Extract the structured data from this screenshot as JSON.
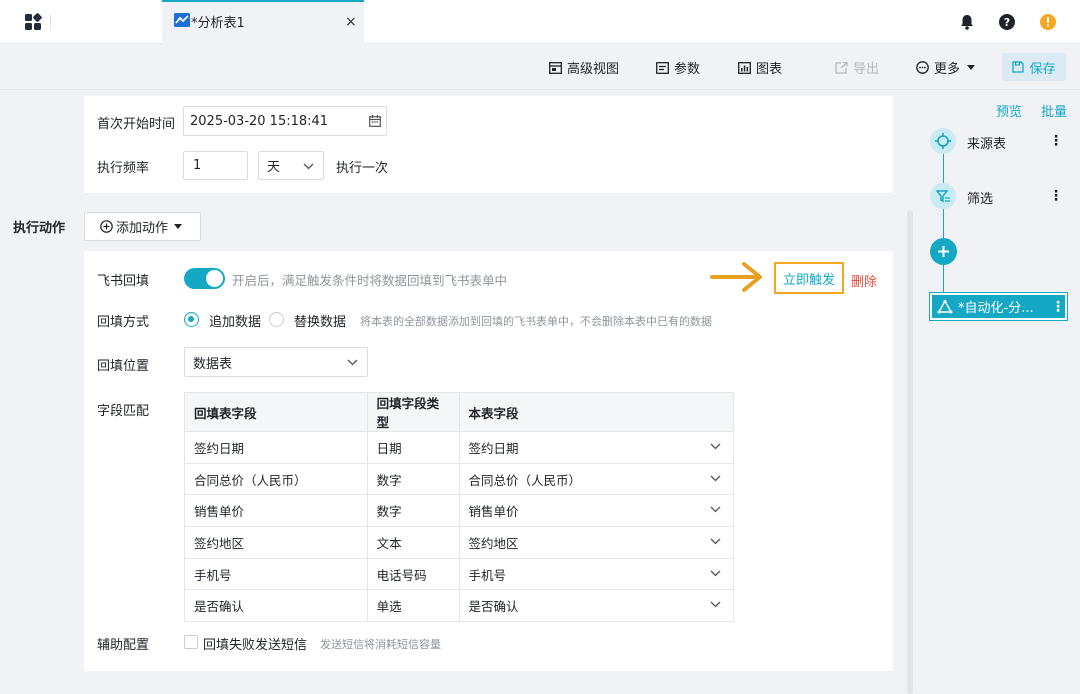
{
  "tab": {
    "title": "*分析表1",
    "close": "×"
  },
  "toolbar": {
    "advanced_view": "高级视图",
    "params": "参数",
    "chart": "图表",
    "export": "导出",
    "more": "更多",
    "save": "保存"
  },
  "schedule": {
    "first_start_label": "首次开始时间",
    "first_start_value": "2025-03-20 15:18:41",
    "frequency_label": "执行频率",
    "frequency_value": "1",
    "frequency_unit": "天",
    "frequency_suffix": "执行一次"
  },
  "actions": {
    "section_label": "执行动作",
    "add_action": "添加动作"
  },
  "writeback": {
    "feishu_label": "飞书回填",
    "toggle_on": true,
    "toggle_hint": "开启后，满足触发条件时将数据回填到飞书表单中",
    "trigger_now": "立即触发",
    "delete": "删除",
    "mode_label": "回填方式",
    "mode_append": "追加数据",
    "mode_replace": "替换数据",
    "mode_hint": "将本表的全部数据添加到回填的飞书表单中，不会删除本表中已有的数据",
    "position_label": "回填位置",
    "position_value": "数据表",
    "field_match_label": "字段匹配",
    "table_headers": [
      "回填表字段",
      "回填字段类型",
      "本表字段"
    ],
    "rows": [
      [
        "签约日期",
        "日期",
        "签约日期"
      ],
      [
        "合同总价（人民币）",
        "数字",
        "合同总价（人民币）"
      ],
      [
        "销售单价",
        "数字",
        "销售单价"
      ],
      [
        "签约地区",
        "文本",
        "签约地区"
      ],
      [
        "手机号",
        "电话号码",
        "手机号"
      ],
      [
        "是否确认",
        "单选",
        "是否确认"
      ]
    ],
    "aux_label": "辅助配置",
    "aux_sms": "回填失败发送短信",
    "aux_hint": "发送短信将消耗短信容量"
  },
  "flow": {
    "preview": "预览",
    "batch": "批量",
    "nodes": [
      {
        "label": "来源表",
        "icon": "source-icon"
      },
      {
        "label": "筛选",
        "icon": "filter-icon"
      },
      {
        "label": "*自动化-分...",
        "icon": "automation-icon"
      }
    ],
    "menu": "⋮"
  },
  "colors": {
    "accent": "#14a8c5",
    "warning": "#f5a623",
    "danger": "#e04d3c",
    "arrow": "#e8a020"
  }
}
